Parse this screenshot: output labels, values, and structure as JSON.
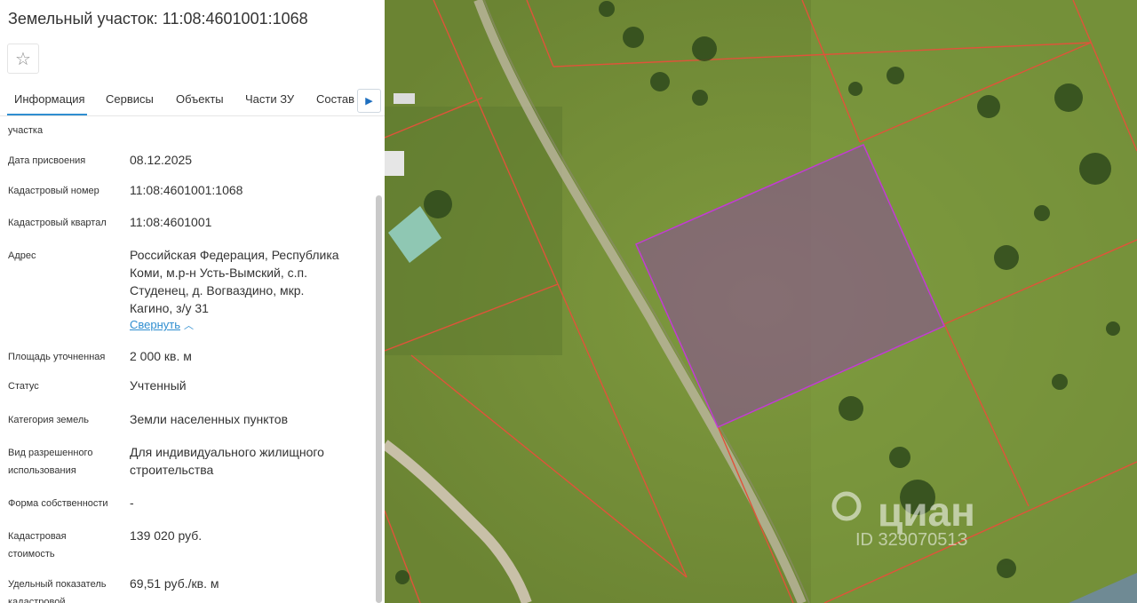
{
  "title": "Земельный участок: 11:08:4601001:1068",
  "favorite_icon": "star-icon",
  "tabs": [
    "Информация",
    "Сервисы",
    "Объекты",
    "Части ЗУ",
    "Состав"
  ],
  "active_tab": "Информация",
  "cut_label": "участка",
  "fields": [
    {
      "label": "Дата присвоения",
      "value": "08.12.2025"
    },
    {
      "label": "Кадастровый номер",
      "value": "11:08:4601001:1068"
    },
    {
      "label": "Кадастровый квартал",
      "value": "11:08:4601001"
    },
    {
      "label": "Адрес",
      "value_lines": [
        "Российская Федерация, Республика",
        "Коми, м.р-н Усть-Вымский, с.п.",
        "Студенец, д. Вогваздино, мкр.",
        "Кагино, з/у 31"
      ]
    },
    {
      "label": "Площадь уточненная",
      "value": "2 000 кв. м"
    },
    {
      "label": "Статус",
      "value": "Учтенный"
    },
    {
      "label": "Категория земель",
      "value": "Земли населенных пунктов"
    },
    {
      "label_lines": [
        "Вид разрешенного",
        "использования"
      ],
      "value_lines": [
        "Для индивидуального жилищного",
        "строительства"
      ]
    },
    {
      "label": "Форма собственности",
      "value": "-"
    },
    {
      "label_lines": [
        "Кадастровая",
        "стоимость"
      ],
      "value": "139 020 руб."
    },
    {
      "label_lines": [
        "Удельный показатель",
        "кадастровой"
      ],
      "value": "69,51 руб./кв. м"
    }
  ],
  "collapse_link": "Свернуть",
  "map": {
    "watermark_brand": "циан",
    "watermark_id": "ID 32907051З",
    "parcel_border_color": "#c23bd4",
    "boundary_color": "#e0533a"
  }
}
